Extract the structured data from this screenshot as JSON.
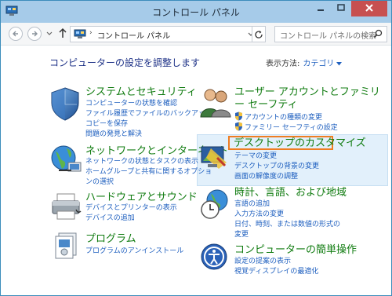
{
  "window": {
    "title": "コントロール パネル"
  },
  "navbar": {
    "address": "コントロール パネル",
    "address_separator": "›",
    "search_placeholder": "コントロール パネルの検索"
  },
  "main": {
    "heading": "コンピューターの設定を調整します",
    "view_by_label": "表示方法:",
    "view_by_value": "カテゴリ"
  },
  "categories": {
    "system": {
      "title": "システムとセキュリティ",
      "links": [
        "コンピューターの状態を確認",
        "ファイル履歴でファイルのバックアップ",
        "コピーを保存",
        "問題の発見と解決"
      ]
    },
    "network": {
      "title": "ネットワークとインターネット",
      "links": [
        "ネットワークの状態とタスクの表示",
        "ホームグループと共有に関するオプショ",
        "ンの選択"
      ]
    },
    "hardware": {
      "title": "ハードウェアとサウンド",
      "links": [
        "デバイスとプリンターの表示",
        "デバイスの追加"
      ]
    },
    "programs": {
      "title": "プログラム",
      "links": [
        "プログラムのアンインストール"
      ]
    },
    "user": {
      "title_line1": "ユーザー アカウントとファミリ",
      "title_line2": "ー セーフティ",
      "links": [
        "アカウントの種類の変更",
        "ファミリー セーフティの設定"
      ]
    },
    "appearance": {
      "title": "デスクトップのカスタマイズ",
      "links": [
        "テーマの変更",
        "デスクトップの背景の変更",
        "画面の解像度の調整"
      ]
    },
    "clock": {
      "title": "時計、言語、および地域",
      "links": [
        "言語の追加",
        "入力方法の変更",
        "日付、時刻、または数値の形式の",
        "変更"
      ]
    },
    "ease": {
      "title": "コンピューターの簡単操作",
      "links": [
        "設定の提案の表示",
        "視覚ディスプレイの最適化"
      ]
    }
  },
  "colors": {
    "titlebar": "#a6cbe9",
    "close": "#c75050",
    "category_title": "#117c11",
    "link": "#1e5fbf",
    "heading": "#1e3287",
    "highlight": "#e2f0fb",
    "frame": "#ef7d22"
  },
  "icons": {
    "window": "control-panel-icon",
    "system": "security-shield-icon",
    "network": "network-globe-icon",
    "hardware": "printer-icon",
    "programs": "programs-icon",
    "user": "users-icon",
    "appearance": "desktop-display-icon",
    "clock": "clock-globe-icon",
    "ease": "ease-of-access-icon"
  }
}
